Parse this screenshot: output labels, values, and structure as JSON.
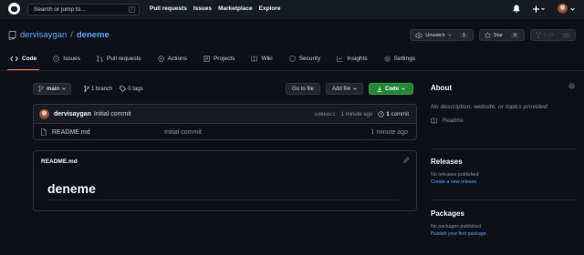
{
  "header": {
    "search_placeholder": "Search or jump to...",
    "search_shortcut": "/",
    "nav": [
      "Pull requests",
      "Issues",
      "Marketplace",
      "Explore"
    ]
  },
  "repo": {
    "owner": "dervisaygan",
    "separator": "/",
    "name": "deneme",
    "watch_label": "Unwatch",
    "watch_count": "1",
    "star_label": "Star",
    "star_count": "0",
    "fork_label": "Fork",
    "fork_count": "0"
  },
  "tabs": [
    {
      "label": "Code",
      "icon": "code-icon",
      "active": true
    },
    {
      "label": "Issues",
      "icon": "issue-icon"
    },
    {
      "label": "Pull requests",
      "icon": "pull-request-icon"
    },
    {
      "label": "Actions",
      "icon": "play-icon"
    },
    {
      "label": "Projects",
      "icon": "project-icon"
    },
    {
      "label": "Wiki",
      "icon": "book-icon"
    },
    {
      "label": "Security",
      "icon": "shield-icon"
    },
    {
      "label": "Insights",
      "icon": "graph-icon"
    },
    {
      "label": "Settings",
      "icon": "gear-icon"
    }
  ],
  "toolbar": {
    "branch": "main",
    "branches": "1 branch",
    "tags": "0 tags",
    "goto_file": "Go to file",
    "add_file": "Add file",
    "code": "Code"
  },
  "commit": {
    "author": "dervisaygan",
    "message": "Initial commit",
    "sha": "1d8b6c1",
    "time": "1 minute ago",
    "count": "1",
    "count_label": "commit"
  },
  "files": [
    {
      "name": "README.md",
      "message": "Initial commit",
      "time": "1 minute ago"
    }
  ],
  "readme": {
    "filename": "README.md",
    "heading": "deneme"
  },
  "sidebar": {
    "about_title": "About",
    "about_desc": "No description, website, or topics provided.",
    "readme_link": "Readme",
    "releases_title": "Releases",
    "releases_none": "No releases published",
    "releases_link": "Create a new release",
    "packages_title": "Packages",
    "packages_none": "No packages published",
    "packages_link": "Publish your first package"
  },
  "colors": {
    "background": "#0d1117",
    "header": "#161b22",
    "link": "#58a6ff",
    "accent_green": "#238636",
    "active_tab": "#f78166"
  }
}
